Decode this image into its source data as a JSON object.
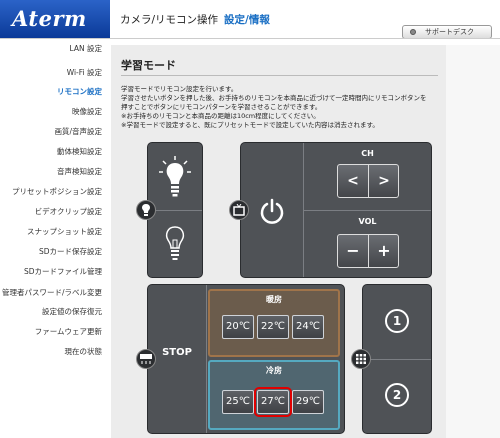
{
  "header": {
    "logo": "Aterm",
    "title": "カメラ/リモコン操作",
    "subtitle": "設定/情報",
    "support_label": "サポートデスク"
  },
  "sidebar": {
    "items": [
      {
        "label": "LAN 設定",
        "active": false
      },
      {
        "label": "Wi-Fi 設定",
        "active": false
      },
      {
        "label": "リモコン設定",
        "active": true
      },
      {
        "label": "映像設定",
        "active": false
      },
      {
        "label": "画質/音声設定",
        "active": false
      },
      {
        "label": "動体検知設定",
        "active": false
      },
      {
        "label": "音声検知設定",
        "active": false
      },
      {
        "label": "プリセットポジション設定",
        "active": false
      },
      {
        "label": "ビデオクリップ設定",
        "active": false
      },
      {
        "label": "スナップショット設定",
        "active": false
      },
      {
        "label": "SDカード保存設定",
        "active": false
      },
      {
        "label": "SDカードファイル管理",
        "active": false
      },
      {
        "label": "管理者パスワード/ラベル変更",
        "active": false
      },
      {
        "label": "設定値の保存復元",
        "active": false
      },
      {
        "label": "ファームウェア更新",
        "active": false
      },
      {
        "label": "現在の状態",
        "active": false
      }
    ]
  },
  "main": {
    "title": "学習モード",
    "desc": [
      "学習モードでリモコン設定を行います。",
      "学習させたいボタンを押した後、お手持ちのリモコンを本商品に近づけて一定時間内にリモコンボタンを",
      "押すことでボタンにリモコンパターンを学習させることができます。",
      "※お手持ちのリモコンと本商品の距離は10cm程度にしてください。",
      "※学習モードで設定すると、既にプリセットモードで設定していた内容は消去されます。"
    ]
  },
  "remote": {
    "ch_label": "CH",
    "ch_prev": "<",
    "ch_next": ">",
    "vol_label": "VOL",
    "vol_minus": "−",
    "vol_plus": "+",
    "power_glyph": "⏻",
    "stop_label": "STOP",
    "heat_label": "暖房",
    "heat_temps": [
      "20℃",
      "22℃",
      "24℃"
    ],
    "cool_label": "冷房",
    "cool_temps": [
      "25℃",
      "27℃",
      "29℃"
    ],
    "num1": "1",
    "num2": "2",
    "selected_temp": "27℃",
    "colors": {
      "panel": "#4f5256",
      "heat_border": "#a0744a",
      "cool_border": "#55a9c0",
      "highlight": "#e00000"
    }
  }
}
